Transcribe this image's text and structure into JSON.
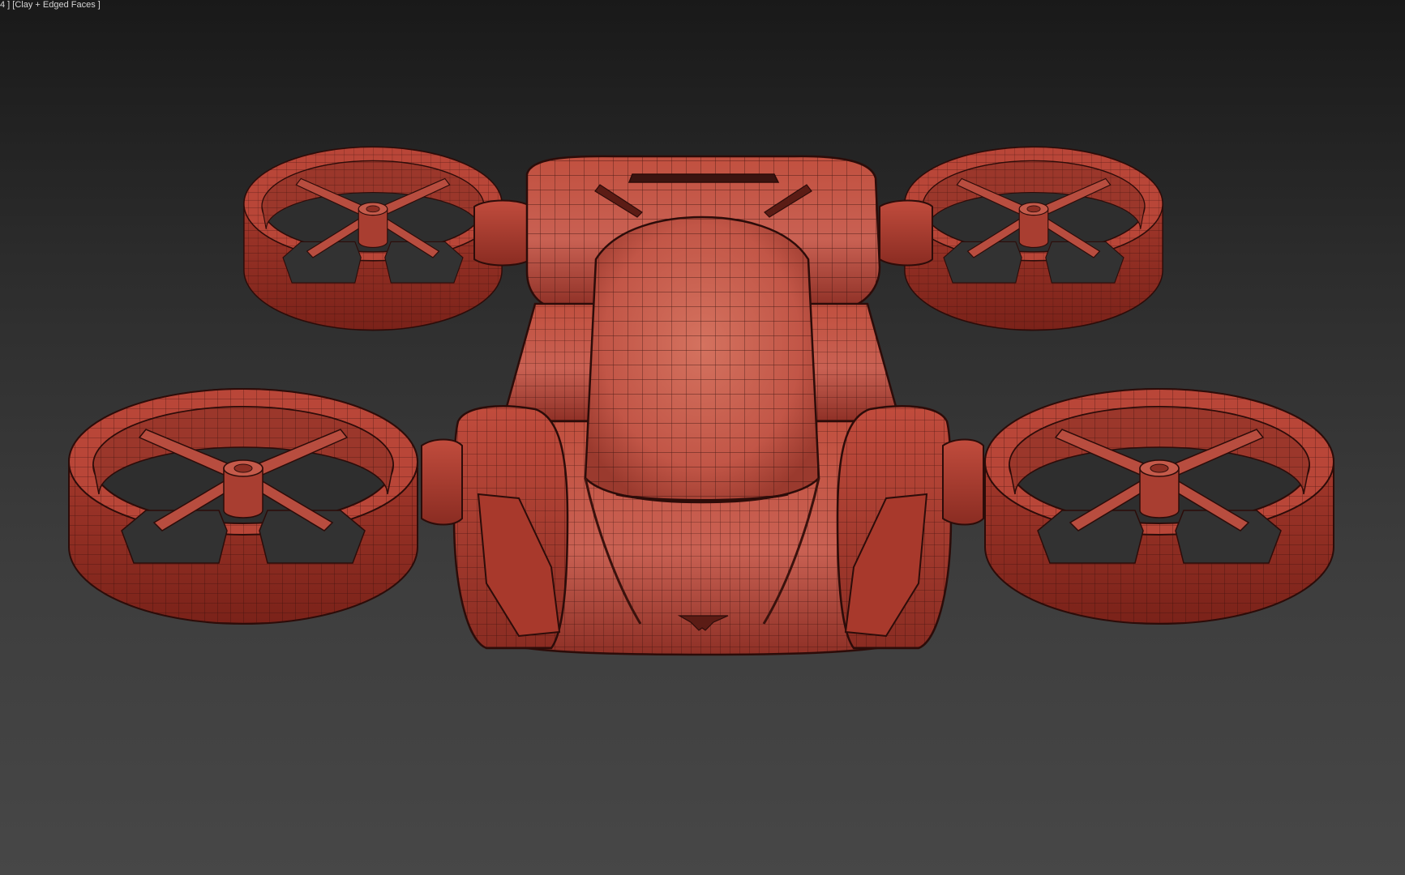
{
  "viewport": {
    "label": "4 ] [Clay + Edged Faces ]"
  },
  "colors": {
    "clay": "#b8463b",
    "clay_highlight": "#d26a5c",
    "clay_shadow": "#6e2019",
    "edge": "#2c0c09",
    "background_top": "#191919",
    "background_bottom": "#474747"
  }
}
